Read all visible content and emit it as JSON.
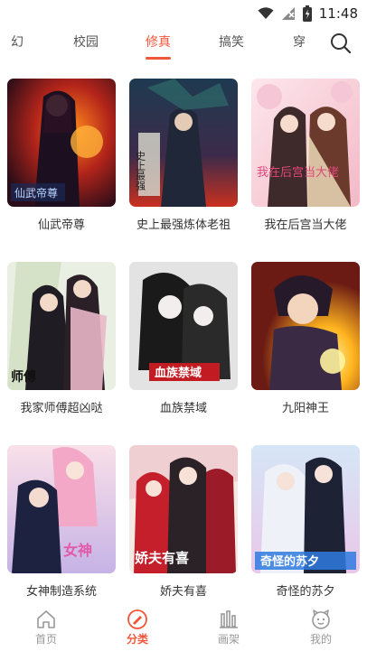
{
  "status_bar": {
    "time": "11:48"
  },
  "colors": {
    "accent": "#f0563a",
    "inactive": "#999999"
  },
  "tabs": [
    {
      "label": "幻",
      "active": false
    },
    {
      "label": "校园",
      "active": false
    },
    {
      "label": "修真",
      "active": true
    },
    {
      "label": "搞笑",
      "active": false
    },
    {
      "label": "穿",
      "active": false
    }
  ],
  "comics": [
    {
      "title": "仙武帝尊",
      "cover_text": "仙武帝尊"
    },
    {
      "title": "史上最强炼体老祖",
      "cover_text": "史上最强"
    },
    {
      "title": "我在后宫当大佬",
      "cover_text": "我在后宫当大佬"
    },
    {
      "title": "我家师傅超凶哒",
      "cover_text": "师傅"
    },
    {
      "title": "血族禁域",
      "cover_text": "血族禁域"
    },
    {
      "title": "九阳神王",
      "cover_text": ""
    },
    {
      "title": "女神制造系统",
      "cover_text": "女神"
    },
    {
      "title": "娇夫有喜",
      "cover_text": "娇夫有喜"
    },
    {
      "title": "奇怪的苏夕",
      "cover_text": "奇怪的苏夕"
    }
  ],
  "bottom_nav": [
    {
      "label": "首页",
      "icon": "home-icon",
      "active": false
    },
    {
      "label": "分类",
      "icon": "category-icon",
      "active": true
    },
    {
      "label": "画架",
      "icon": "bookshelf-icon",
      "active": false
    },
    {
      "label": "我的",
      "icon": "profile-icon",
      "active": false
    }
  ]
}
